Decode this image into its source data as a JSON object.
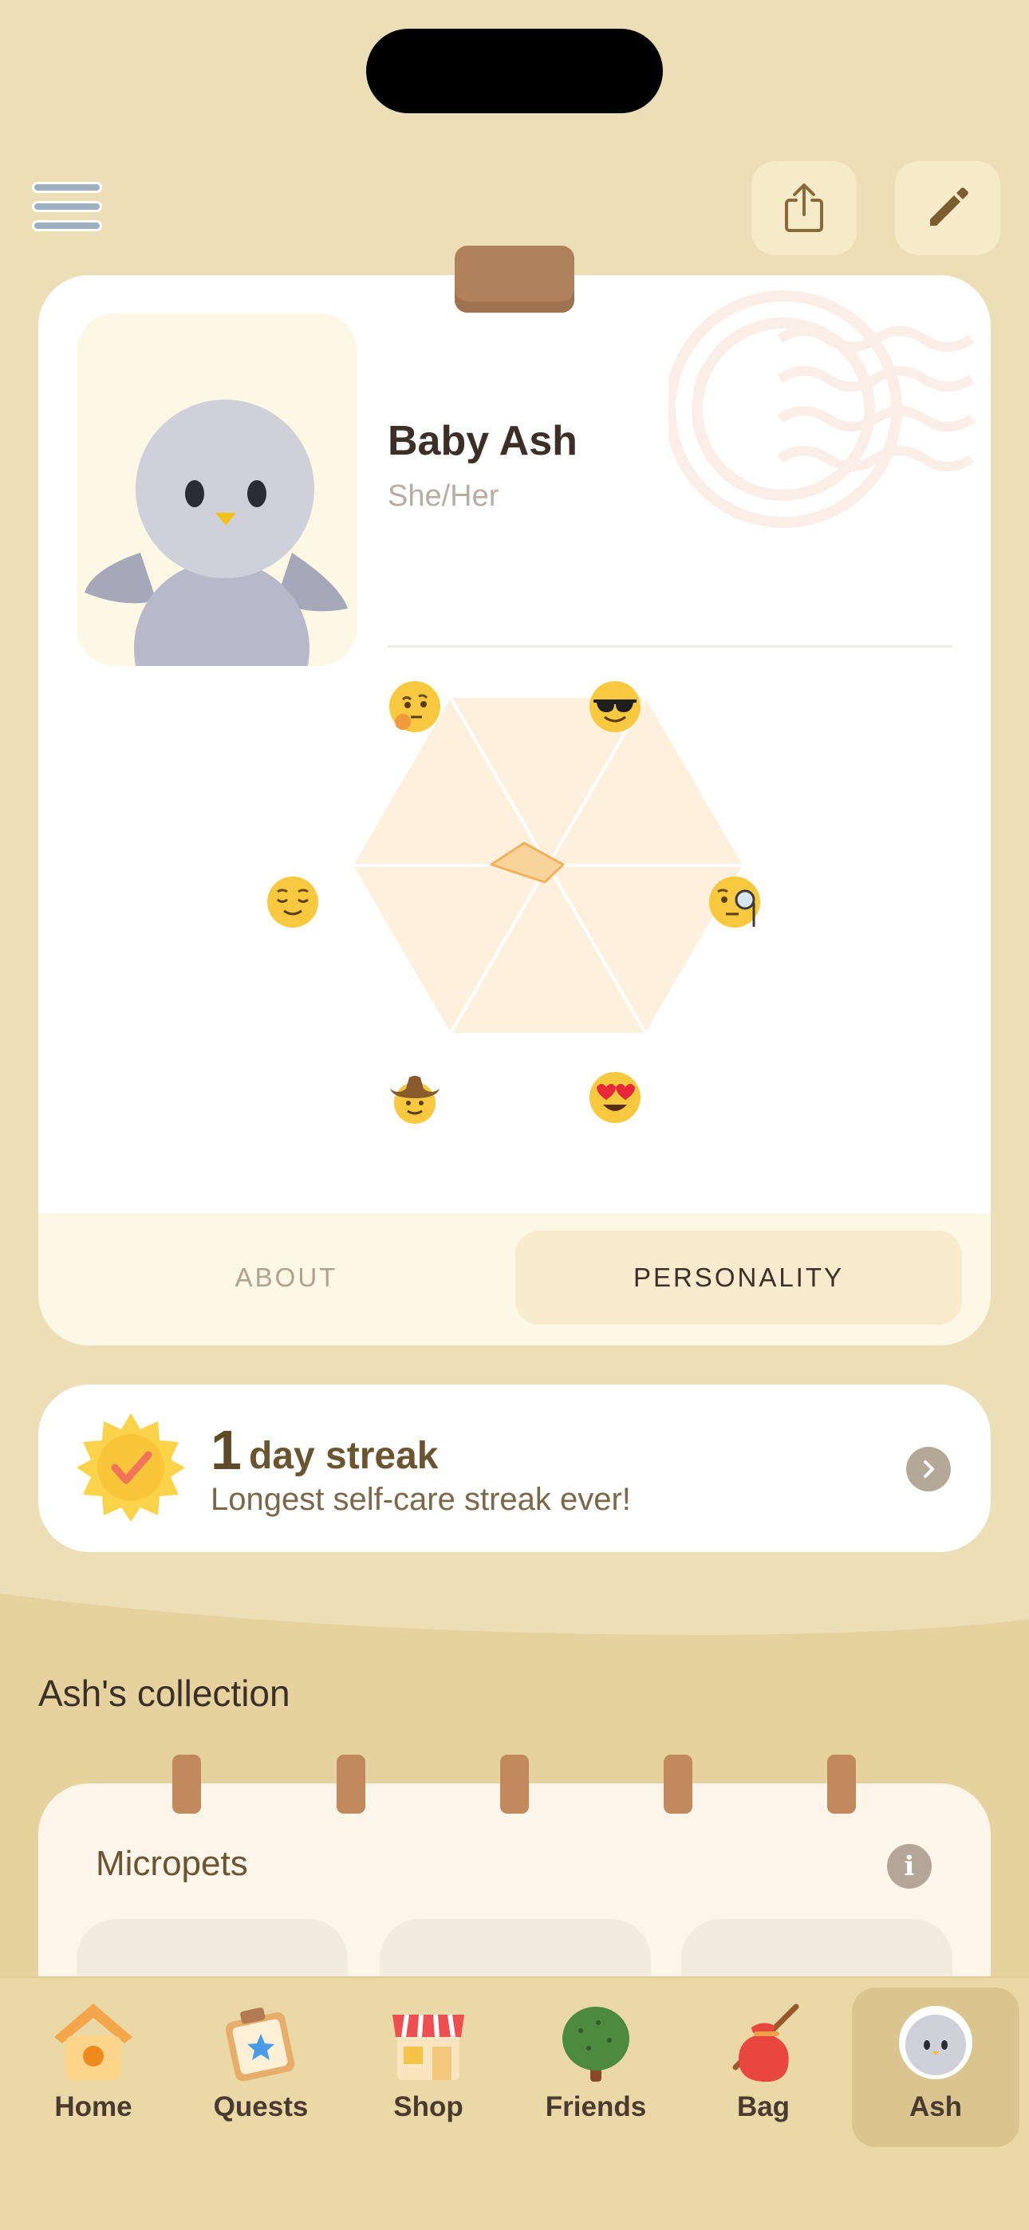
{
  "header": {
    "menu_icon": "hamburger-menu-icon",
    "share_icon": "share-icon",
    "edit_icon": "pencil-icon"
  },
  "profile": {
    "name": "Baby Ash",
    "pronouns": "She/Her",
    "avatar": "gray-bird-avatar"
  },
  "personality_chart": {
    "traits": [
      {
        "icon": "thinking-face-emoji"
      },
      {
        "icon": "sunglasses-face-emoji"
      },
      {
        "icon": "monocle-face-emoji"
      },
      {
        "icon": "heart-eyes-face-emoji"
      },
      {
        "icon": "cowboy-face-emoji"
      },
      {
        "icon": "relieved-face-emoji"
      }
    ],
    "accent_color": "#f7c680"
  },
  "tabs": [
    {
      "label": "ABOUT",
      "active": false
    },
    {
      "label": "PERSONALITY",
      "active": true
    }
  ],
  "streak": {
    "count": "1",
    "label": "day streak",
    "subtitle": "Longest self-care streak ever!",
    "badge_icon": "sun-checkmark-badge-icon"
  },
  "collection": {
    "title": "Ash's collection",
    "section_label": "Micropets",
    "info_icon": "info-icon"
  },
  "nav": {
    "items": [
      {
        "label": "Home",
        "icon": "birdhouse-icon",
        "active": false
      },
      {
        "label": "Quests",
        "icon": "quest-board-icon",
        "active": false
      },
      {
        "label": "Shop",
        "icon": "shop-icon",
        "active": false
      },
      {
        "label": "Friends",
        "icon": "tree-icon",
        "active": false
      },
      {
        "label": "Bag",
        "icon": "bag-icon",
        "active": false
      },
      {
        "label": "Ash",
        "icon": "pet-avatar-icon",
        "active": true
      }
    ]
  }
}
